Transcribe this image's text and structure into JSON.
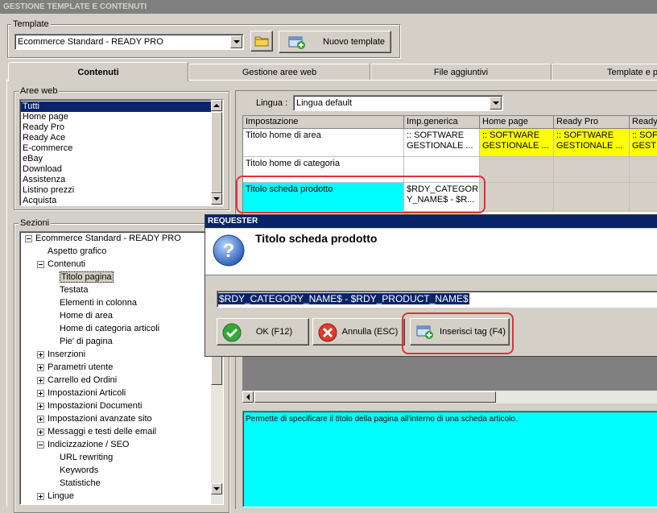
{
  "window": {
    "title": "GESTIONE TEMPLATE E CONTENUTI"
  },
  "template_group": {
    "label": "Template",
    "selected": "Ecommerce Standard - READY PRO",
    "new_button": "Nuovo template"
  },
  "tabs": [
    "Contenuti",
    "Gestione aree web",
    "File aggiuntivi",
    "Template e p"
  ],
  "aree_web": {
    "label": "Aree web",
    "items": [
      "Tutti",
      "Home page",
      "Ready Pro",
      "Ready Ace",
      "E-commerce",
      "eBay",
      "Download",
      "Assistenza",
      "Listino prezzi",
      "Acquista"
    ]
  },
  "sezioni": {
    "label": "Sezioni",
    "tree": [
      {
        "text": "Ecommerce Standard - READY PRO",
        "level": 0,
        "toggle": "open"
      },
      {
        "text": "Aspetto grafico",
        "level": 1,
        "toggle": "none"
      },
      {
        "text": "Contenuti",
        "level": 1,
        "toggle": "open"
      },
      {
        "text": "Titolo pagina",
        "level": 2,
        "toggle": "none",
        "selected": true
      },
      {
        "text": "Testata",
        "level": 2,
        "toggle": "none"
      },
      {
        "text": "Elementi in colonna",
        "level": 2,
        "toggle": "none"
      },
      {
        "text": "Home di area",
        "level": 2,
        "toggle": "none"
      },
      {
        "text": "Home di categoria articoli",
        "level": 2,
        "toggle": "none"
      },
      {
        "text": "Pie' di pagina",
        "level": 2,
        "toggle": "none"
      },
      {
        "text": "Inserzioni",
        "level": 1,
        "toggle": "closed"
      },
      {
        "text": "Parametri utente",
        "level": 1,
        "toggle": "closed"
      },
      {
        "text": "Carrello ed Ordini",
        "level": 1,
        "toggle": "closed"
      },
      {
        "text": "Impostazioni Articoli",
        "level": 1,
        "toggle": "closed"
      },
      {
        "text": "Impostazioni Documenti",
        "level": 1,
        "toggle": "closed"
      },
      {
        "text": "Impostazioni avanzate sito",
        "level": 1,
        "toggle": "closed"
      },
      {
        "text": "Messaggi e testi delle email",
        "level": 1,
        "toggle": "closed"
      },
      {
        "text": "Indicizzazione / SEO",
        "level": 1,
        "toggle": "open"
      },
      {
        "text": "URL rewriting",
        "level": 2,
        "toggle": "none"
      },
      {
        "text": "Keywords",
        "level": 2,
        "toggle": "none"
      },
      {
        "text": "Statistiche",
        "level": 2,
        "toggle": "none"
      },
      {
        "text": "Lingue",
        "level": 1,
        "toggle": "closed"
      }
    ]
  },
  "lingua": {
    "label": "Lingua :",
    "selected": "Lingua default"
  },
  "grid": {
    "headers": [
      "Impostazione",
      "Imp.generica",
      "Home page",
      "Ready Pro",
      "Ready"
    ],
    "rows": [
      {
        "name": "Titolo home di area",
        "generic": [
          ":: SOFTWARE",
          "GESTIONALE ..."
        ],
        "home": [
          ":: SOFTWARE",
          "GESTIONALE ..."
        ],
        "readypro": [
          ":: SOFTWARE",
          "GESTIONALE ..."
        ],
        "ready": [
          ":: SOFT",
          "GESTI"
        ]
      },
      {
        "name": "Titolo home di categoria",
        "generic": [
          "",
          ""
        ]
      },
      {
        "name": "Titolo scheda prodotto",
        "generic": [
          "$RDY_CATEGOR",
          "Y_NAME$ - $R..."
        ]
      }
    ]
  },
  "description": "Permette di specificare il titolo della pagina all'interno di una scheda articolo.",
  "dialog": {
    "title": "REQUESTER",
    "heading": "Titolo scheda prodotto",
    "value": "$RDY_CATEGORY_NAME$ - $RDY_PRODUCT_NAME$",
    "ok": "OK (F12)",
    "cancel": "Annulla (ESC)",
    "insert": "Inserisci tag (F4)"
  },
  "colors": {
    "highlight_yellow": "#ffff00",
    "cyan": "#00ffff",
    "selection": "#0a246a",
    "annotation_red": "#e0303a"
  }
}
